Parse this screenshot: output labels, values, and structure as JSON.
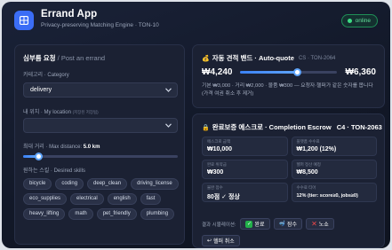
{
  "header": {
    "title": "Errand App",
    "subtitle": "Privacy-preserving Matching Engine · TON-10",
    "status": "online"
  },
  "request": {
    "title": "심부름 요청",
    "title_sub": " / Post an errand",
    "category_label": "카테고리 · Category",
    "category_value": "delivery",
    "location_label": "내 위치 · My location",
    "location_hint": "(저장된 저장됨)",
    "location_value": "",
    "distance_label": "최대 거리 · Max distance: ",
    "distance_value": "5.0 km",
    "distance_fraction": 0.1,
    "skills_label": "원하는 스킬 · Desired skills",
    "skills": [
      "bicycle",
      "coding",
      "deep_clean",
      "driving_license",
      "eco_supplies",
      "electrical",
      "english",
      "fast",
      "heavy_lifting",
      "math",
      "pet_friendly",
      "plumbing"
    ]
  },
  "quote": {
    "title": "자동 견적 밴드 · Auto-quote",
    "tag": "CS · TON-2064",
    "low": "₩4,240",
    "high": "₩6,360",
    "position_fraction": 0.59,
    "note": "기본 ₩3,000 · 거리 ₩2,000 · 물품 ₩300 — 요청자·헬퍼가 같은 숫자를 봅니다 (가격 여권 취소 후 제거)"
  },
  "escrow": {
    "title": "완료보증 에스크로 · Completion Escrow",
    "tag": "C4 · TON-2063",
    "cells": [
      {
        "label": "에스크로 금액",
        "value": "₩10,000"
      },
      {
        "label": "플랫폼 수수료",
        "value": "₩1,200 (12%)"
      },
      {
        "label": "완료 위약금",
        "value": "₩300"
      },
      {
        "label": "헬퍼 정산 예정",
        "value": "₩8,500"
      },
      {
        "label": "불완 점수",
        "value": "80점 ✓ 정상"
      },
      {
        "label": "수수료 티어",
        "value": "12% (tier: score≥0, jobs≥0)"
      }
    ],
    "sim_label": "결과 시뮬레이션:",
    "btn_complete": "완료",
    "btn_noshow_helper": "잠수",
    "btn_noshow": "노쇼",
    "btn_cancel": "헬퍼 취소"
  },
  "colors": {
    "accent": "#3b6df6",
    "online": "#3ddc84",
    "success": "#22b04a",
    "danger": "#f0474a"
  }
}
